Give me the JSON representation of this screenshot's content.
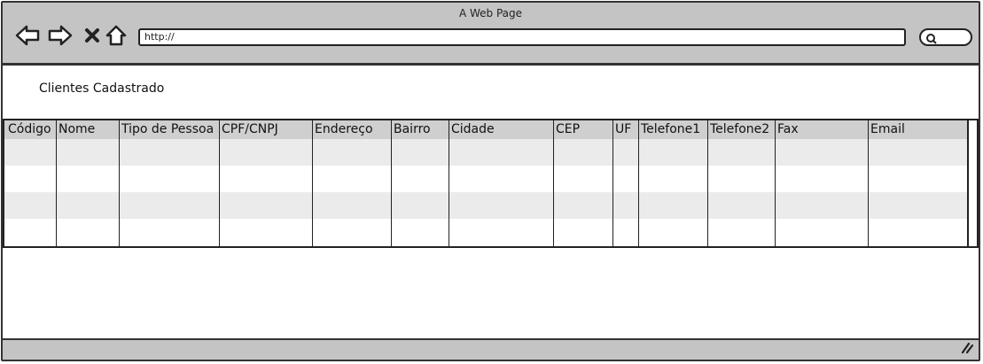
{
  "window": {
    "title": "A Web Page"
  },
  "toolbar": {
    "back_icon": "back-arrow-icon",
    "forward_icon": "forward-arrow-icon",
    "stop_icon": "close-icon",
    "home_icon": "home-icon"
  },
  "address_bar": {
    "value": "http://"
  },
  "search": {
    "icon": "search-icon"
  },
  "page": {
    "heading": "Clientes Cadastrado"
  },
  "table": {
    "columns": [
      "Código",
      "Nome",
      "Tipo de Pessoa",
      "CPF/CNPJ",
      "Endereço",
      "Bairro",
      "Cidade",
      "CEP",
      "UF",
      "Telefone1",
      "Telefone2",
      "Fax",
      "Email"
    ],
    "rows": []
  },
  "colors": {
    "chrome": "#c4c4c4",
    "border": "#333333",
    "header": "#cfcfcf",
    "stripe": "#ebebeb"
  }
}
